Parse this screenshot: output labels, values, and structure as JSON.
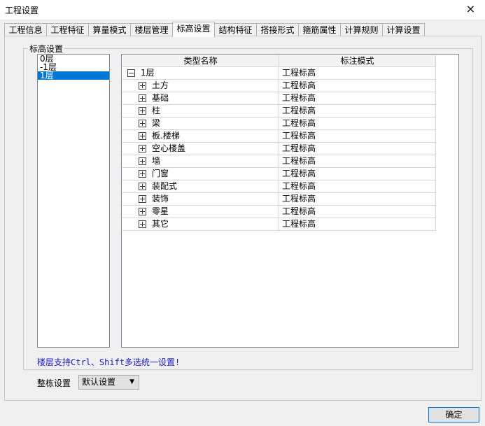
{
  "window": {
    "title": "工程设置",
    "close_icon": "×"
  },
  "tabs": [
    {
      "label": "工程信息"
    },
    {
      "label": "工程特征"
    },
    {
      "label": "算量模式"
    },
    {
      "label": "楼层管理"
    },
    {
      "label": "标高设置"
    },
    {
      "label": "结构特征"
    },
    {
      "label": "搭接形式"
    },
    {
      "label": "箍筋属性"
    },
    {
      "label": "计算规则"
    },
    {
      "label": "计算设置"
    }
  ],
  "active_tab": "标高设置",
  "group_label": "标高设置",
  "floors": [
    {
      "label": "0层",
      "selected": false
    },
    {
      "label": "-1层",
      "selected": false
    },
    {
      "label": "1层",
      "selected": true
    }
  ],
  "grid": {
    "columns": [
      "类型名称",
      "标注模式"
    ],
    "rows": [
      {
        "name": "1层",
        "mode": "工程标高",
        "level": 0,
        "toggle": "minus"
      },
      {
        "name": "土方",
        "mode": "工程标高",
        "level": 1,
        "toggle": "plus"
      },
      {
        "name": "基础",
        "mode": "工程标高",
        "level": 1,
        "toggle": "plus"
      },
      {
        "name": "柱",
        "mode": "工程标高",
        "level": 1,
        "toggle": "plus"
      },
      {
        "name": "梁",
        "mode": "工程标高",
        "level": 1,
        "toggle": "plus"
      },
      {
        "name": "板.楼梯",
        "mode": "工程标高",
        "level": 1,
        "toggle": "plus"
      },
      {
        "name": "空心楼盖",
        "mode": "工程标高",
        "level": 1,
        "toggle": "plus"
      },
      {
        "name": "墙",
        "mode": "工程标高",
        "level": 1,
        "toggle": "plus"
      },
      {
        "name": "门窗",
        "mode": "工程标高",
        "level": 1,
        "toggle": "plus"
      },
      {
        "name": "装配式",
        "mode": "工程标高",
        "level": 1,
        "toggle": "plus"
      },
      {
        "name": "装饰",
        "mode": "工程标高",
        "level": 1,
        "toggle": "plus"
      },
      {
        "name": "零星",
        "mode": "工程标高",
        "level": 1,
        "toggle": "plus"
      },
      {
        "name": "其它",
        "mode": "工程标高",
        "level": 1,
        "toggle": "plus"
      }
    ]
  },
  "note": "楼层支持Ctrl、Shift多选统一设置!",
  "whole_setting": {
    "label": "整栋设置",
    "value": "默认设置",
    "arrow_icon": "chevron-down-icon"
  },
  "ok_button": "确定",
  "colors": {
    "selection": "#0078d7",
    "note": "#1a1ad0"
  }
}
